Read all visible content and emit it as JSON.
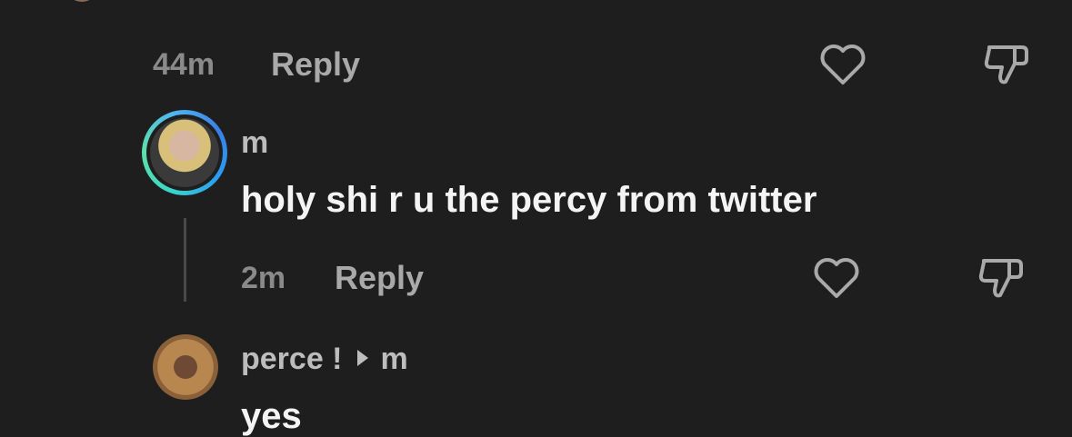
{
  "thread": {
    "prev_comment": {
      "time": "44m",
      "reply_label": "Reply"
    },
    "comment": {
      "username": "m",
      "text": "holy shi r u the percy from twitter",
      "time": "2m",
      "reply_label": "Reply"
    },
    "reply": {
      "username": "perce !",
      "reply_to": "m",
      "text_partial": "yes"
    }
  },
  "icons": {
    "like": "heart-outline-icon",
    "dislike": "thumbs-down-outline-icon",
    "reply_indicator": "play-triangle-icon"
  },
  "colors": {
    "background": "#1e1e1e",
    "muted_text": "#8a8a8a",
    "story_ring_start": "#3ad6c8",
    "story_ring_end": "#3a7fe6"
  }
}
